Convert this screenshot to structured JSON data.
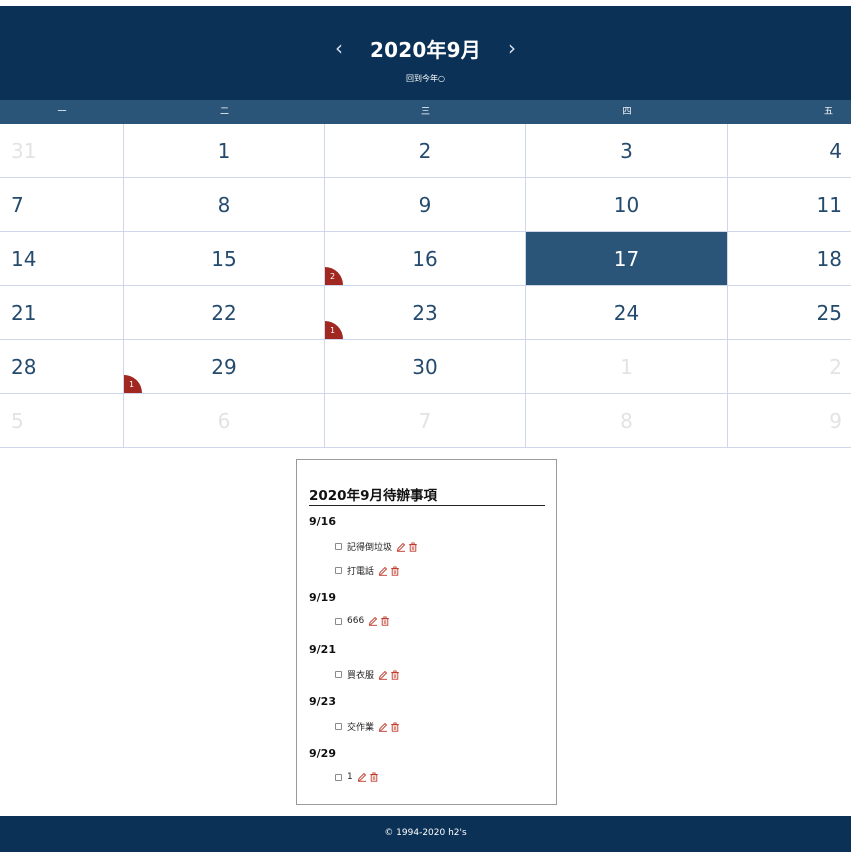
{
  "header": {
    "title": "2020年9月",
    "prev_label": "‹",
    "next_label": "›",
    "today_link": "回到今年○"
  },
  "weekdays": [
    "一",
    "二",
    "三",
    "四",
    "五"
  ],
  "weeks": [
    [
      {
        "n": "31",
        "o": true
      },
      {
        "n": "1"
      },
      {
        "n": "2"
      },
      {
        "n": "3"
      },
      {
        "n": "4"
      }
    ],
    [
      {
        "n": "7"
      },
      {
        "n": "8"
      },
      {
        "n": "9"
      },
      {
        "n": "10"
      },
      {
        "n": "11"
      }
    ],
    [
      {
        "n": "14"
      },
      {
        "n": "15"
      },
      {
        "n": "16",
        "badge": "2"
      },
      {
        "n": "17",
        "today": true
      },
      {
        "n": "18"
      }
    ],
    [
      {
        "n": "21"
      },
      {
        "n": "22"
      },
      {
        "n": "23",
        "badge": "1"
      },
      {
        "n": "24"
      },
      {
        "n": "25"
      }
    ],
    [
      {
        "n": "28"
      },
      {
        "n": "29",
        "badge": "1"
      },
      {
        "n": "30"
      },
      {
        "n": "1",
        "o": true
      },
      {
        "n": "2",
        "o": true
      }
    ],
    [
      {
        "n": "5",
        "o": true
      },
      {
        "n": "6",
        "o": true
      },
      {
        "n": "7",
        "o": true
      },
      {
        "n": "8",
        "o": true
      },
      {
        "n": "9",
        "o": true
      }
    ]
  ],
  "todo": {
    "title": "2020年9月待辦事項",
    "groups": [
      {
        "date": "9/16",
        "items": [
          "記得倒垃圾",
          "打電話"
        ]
      },
      {
        "date": "9/19",
        "items": [
          "666"
        ]
      },
      {
        "date": "9/21",
        "items": [
          "買衣服"
        ]
      },
      {
        "date": "9/23",
        "items": [
          "交作業"
        ]
      },
      {
        "date": "9/29",
        "items": [
          "1"
        ]
      }
    ]
  },
  "footer": {
    "text": "© 1994-2020 h2's"
  },
  "colors": {
    "header_bg": "#0b3156",
    "weekday_bg": "#2a5478",
    "today_bg": "#2a5478",
    "badge": "#a12820",
    "action_icon": "#c0392b"
  }
}
